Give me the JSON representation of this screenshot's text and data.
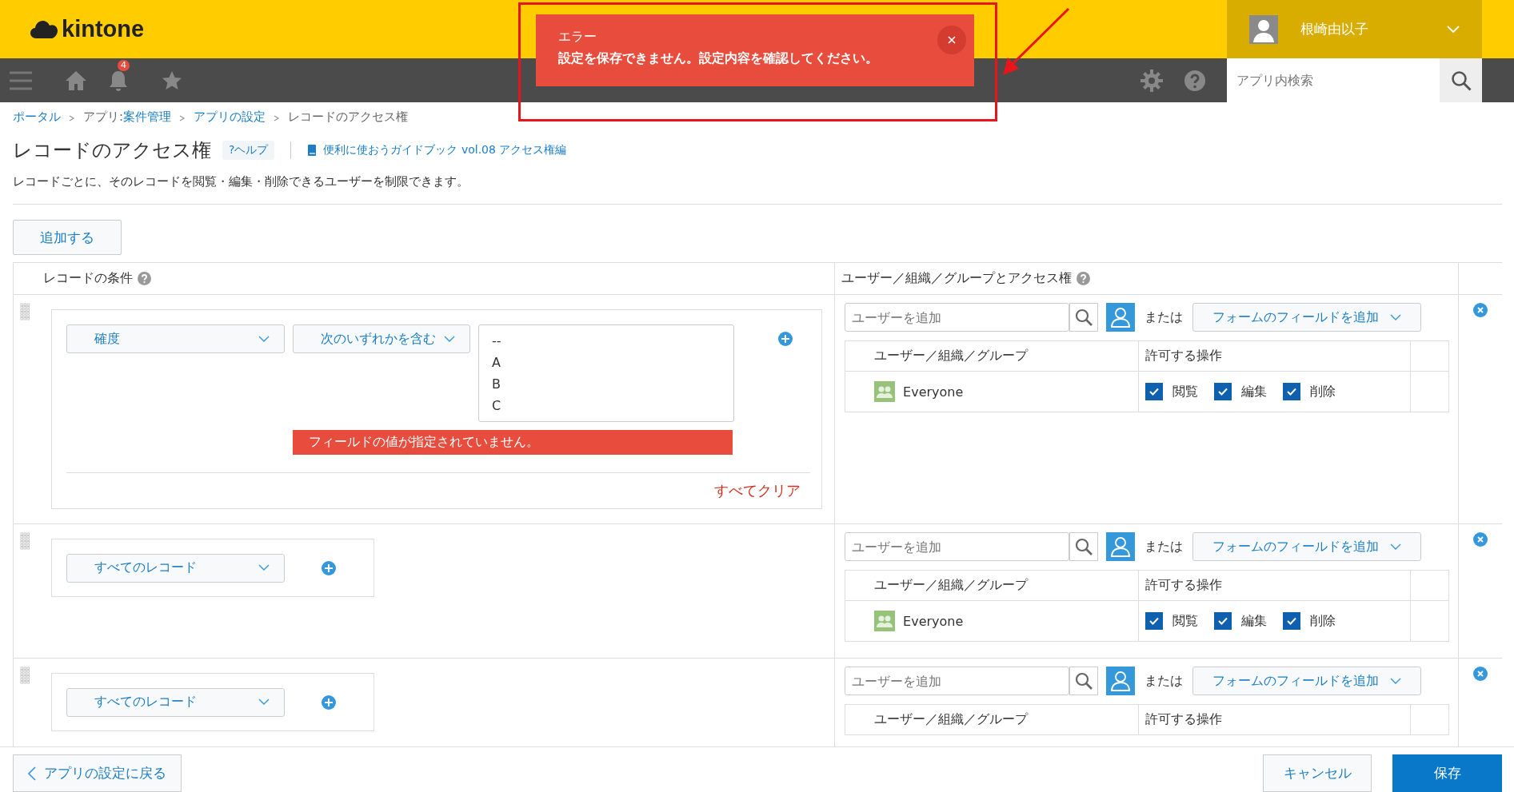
{
  "header": {
    "logo": "kintone",
    "notification_count": "4",
    "user_name": "根崎由以子",
    "search": {
      "placeholder": "アプリ内検索"
    }
  },
  "toast": {
    "title": "エラー",
    "message": "設定を保存できません。設定内容を確認してください。"
  },
  "breadcrumb": [
    {
      "label": "ポータル",
      "link": true
    },
    {
      "prefix": "アプリ: ",
      "label": "案件管理",
      "link": true
    },
    {
      "label": "アプリの設定",
      "link": true
    },
    {
      "label": "レコードのアクセス権",
      "link": false
    }
  ],
  "page": {
    "title": "レコードのアクセス権",
    "help": "?ヘルプ",
    "guide_link": "便利に使おうガイドブック vol.08 アクセス権編",
    "description": "レコードごとに、そのレコードを閲覧・編集・削除できるユーザーを制限できます。"
  },
  "add_button": "追加する",
  "columns": [
    "レコードの条件",
    "ユーザー／組織／グループとアクセス権"
  ],
  "rules": [
    {
      "kind": "condition",
      "field": "確度",
      "operator": "次のいずれかを含む",
      "options": [
        "--",
        "A",
        "B",
        "C"
      ],
      "error": "フィールドの値が指定されていません。",
      "clear": "すべてクリア",
      "access": {
        "placeholder": "ユーザーを追加",
        "or_label": "または",
        "field_button": "フォームのフィールドを追加",
        "table_columns": [
          "ユーザー／組織／グループ",
          "許可する操作"
        ],
        "entries": [
          {
            "name": "Everyone",
            "permissions": [
              {
                "label": "閲覧",
                "checked": true
              },
              {
                "label": "編集",
                "checked": true
              },
              {
                "label": "削除",
                "checked": true
              }
            ]
          }
        ]
      }
    },
    {
      "kind": "all",
      "field": "すべてのレコード",
      "access": {
        "placeholder": "ユーザーを追加",
        "or_label": "または",
        "field_button": "フォームのフィールドを追加",
        "table_columns": [
          "ユーザー／組織／グループ",
          "許可する操作"
        ],
        "entries": [
          {
            "name": "Everyone",
            "permissions": [
              {
                "label": "閲覧",
                "checked": true
              },
              {
                "label": "編集",
                "checked": true
              },
              {
                "label": "削除",
                "checked": true
              }
            ]
          }
        ]
      }
    },
    {
      "kind": "all",
      "field": "すべてのレコード",
      "access": {
        "placeholder": "ユーザーを追加",
        "or_label": "または",
        "field_button": "フォームのフィールドを追加",
        "table_columns": [
          "ユーザー／組織／グループ",
          "許可する操作"
        ]
      }
    }
  ],
  "footer": {
    "back": "アプリの設定に戻る",
    "cancel": "キャンセル",
    "save": "保存"
  }
}
